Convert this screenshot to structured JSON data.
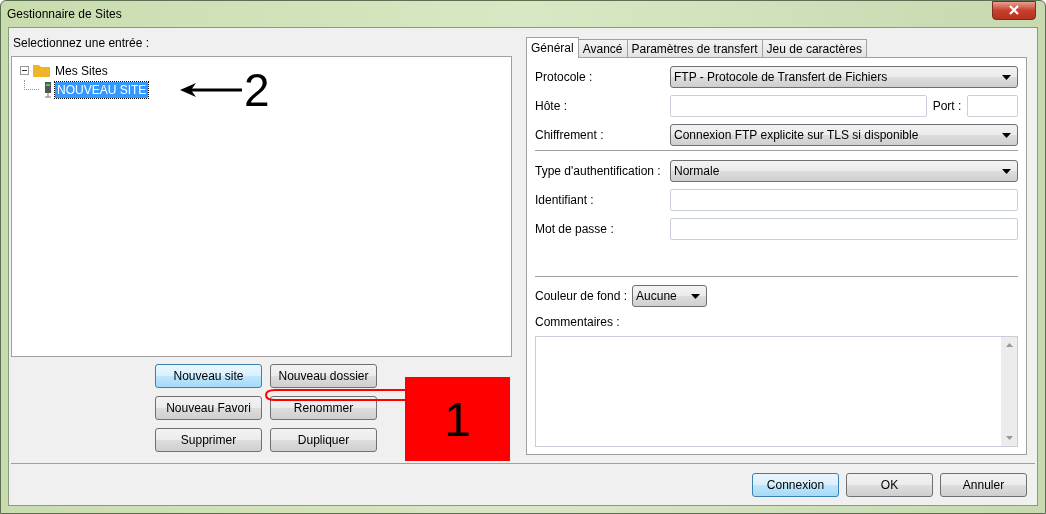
{
  "window": {
    "title": "Gestionnaire de Sites"
  },
  "site_tree": {
    "label": "Selectionnez une entrée :",
    "items": [
      {
        "label": "Mes Sites",
        "kind": "folder",
        "expanded": true,
        "selected": false,
        "children": [
          {
            "label": "NOUVEAU SITE",
            "kind": "site",
            "selected": true
          }
        ]
      }
    ]
  },
  "site_buttons": [
    {
      "label": "Nouveau site",
      "focused": true
    },
    {
      "label": "Nouveau dossier",
      "focused": false
    },
    {
      "label": "Nouveau Favori",
      "focused": false
    },
    {
      "label": "Renommer",
      "focused": false
    },
    {
      "label": "Supprimer",
      "focused": false
    },
    {
      "label": "Dupliquer",
      "focused": false
    }
  ],
  "annotations": [
    {
      "kind": "arrow",
      "label": "2"
    },
    {
      "kind": "hand",
      "label": "1"
    }
  ],
  "tabs": [
    {
      "label": "Général",
      "selected": true
    },
    {
      "label": "Avancé",
      "selected": false
    },
    {
      "label": "Paramètres de transfert",
      "selected": false
    },
    {
      "label": "Jeu de caractères",
      "selected": false
    }
  ],
  "fields": [
    {
      "label": "Protocole :",
      "kind": "select",
      "value": "FTP - Protocole de Transfert de Fichiers"
    },
    {
      "label": "Hôte :",
      "kind": "host",
      "port_label": "Port :"
    },
    {
      "label": "Chiffrement :",
      "kind": "select",
      "value": "Connexion FTP explicite sur TLS si disponible"
    },
    {
      "label": "Type d'authentification :",
      "kind": "select",
      "value": "Normale",
      "separator_before": true
    },
    {
      "label": "Identifiant :",
      "kind": "text"
    },
    {
      "label": "Mot de passe :",
      "kind": "text"
    }
  ],
  "background_color": {
    "label": "Couleur de fond :",
    "value": "Aucune"
  },
  "comments": {
    "label": "Commentaires :"
  },
  "buttons": [
    {
      "label": "Connexion",
      "default": true
    },
    {
      "label": "OK",
      "default": false
    },
    {
      "label": "Annuler",
      "default": false
    }
  ]
}
